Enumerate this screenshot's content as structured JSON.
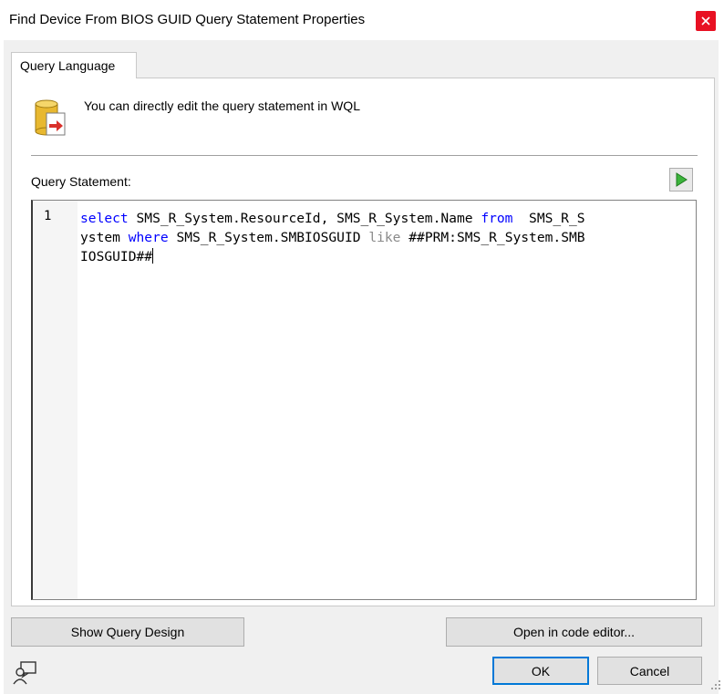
{
  "window": {
    "title": "Find Device From BIOS GUID Query Statement Properties",
    "close_icon": "close-icon"
  },
  "tabs": [
    {
      "label": "Query Language",
      "selected": true
    }
  ],
  "info": {
    "icon": "database-edit-icon",
    "text": "You can directly edit the query statement in WQL"
  },
  "query": {
    "label": "Query Statement:",
    "run_icon": "run-triangle-icon",
    "line_number": "1",
    "tokens": {
      "t1": "select",
      "t2": " SMS_R_System.ResourceId, SMS_R_System.Name ",
      "t3": "from",
      "t4": "  SMS_R_S",
      "t5": "ystem ",
      "t6": "where",
      "t7": " SMS_R_System.SMBIOSGUID ",
      "t8": "like",
      "t9": " ##PRM:SMS_R_System.SMB",
      "t10": "IOSGUID##"
    }
  },
  "buttons": {
    "show_query_design": "Show Query Design",
    "open_in_code_editor": "Open in code editor...",
    "ok": "OK",
    "cancel": "Cancel"
  },
  "colors": {
    "keyword": "#0000ff",
    "operator": "#8a8a8a",
    "close_bg": "#e81123",
    "default_button_border": "#0078d7"
  }
}
